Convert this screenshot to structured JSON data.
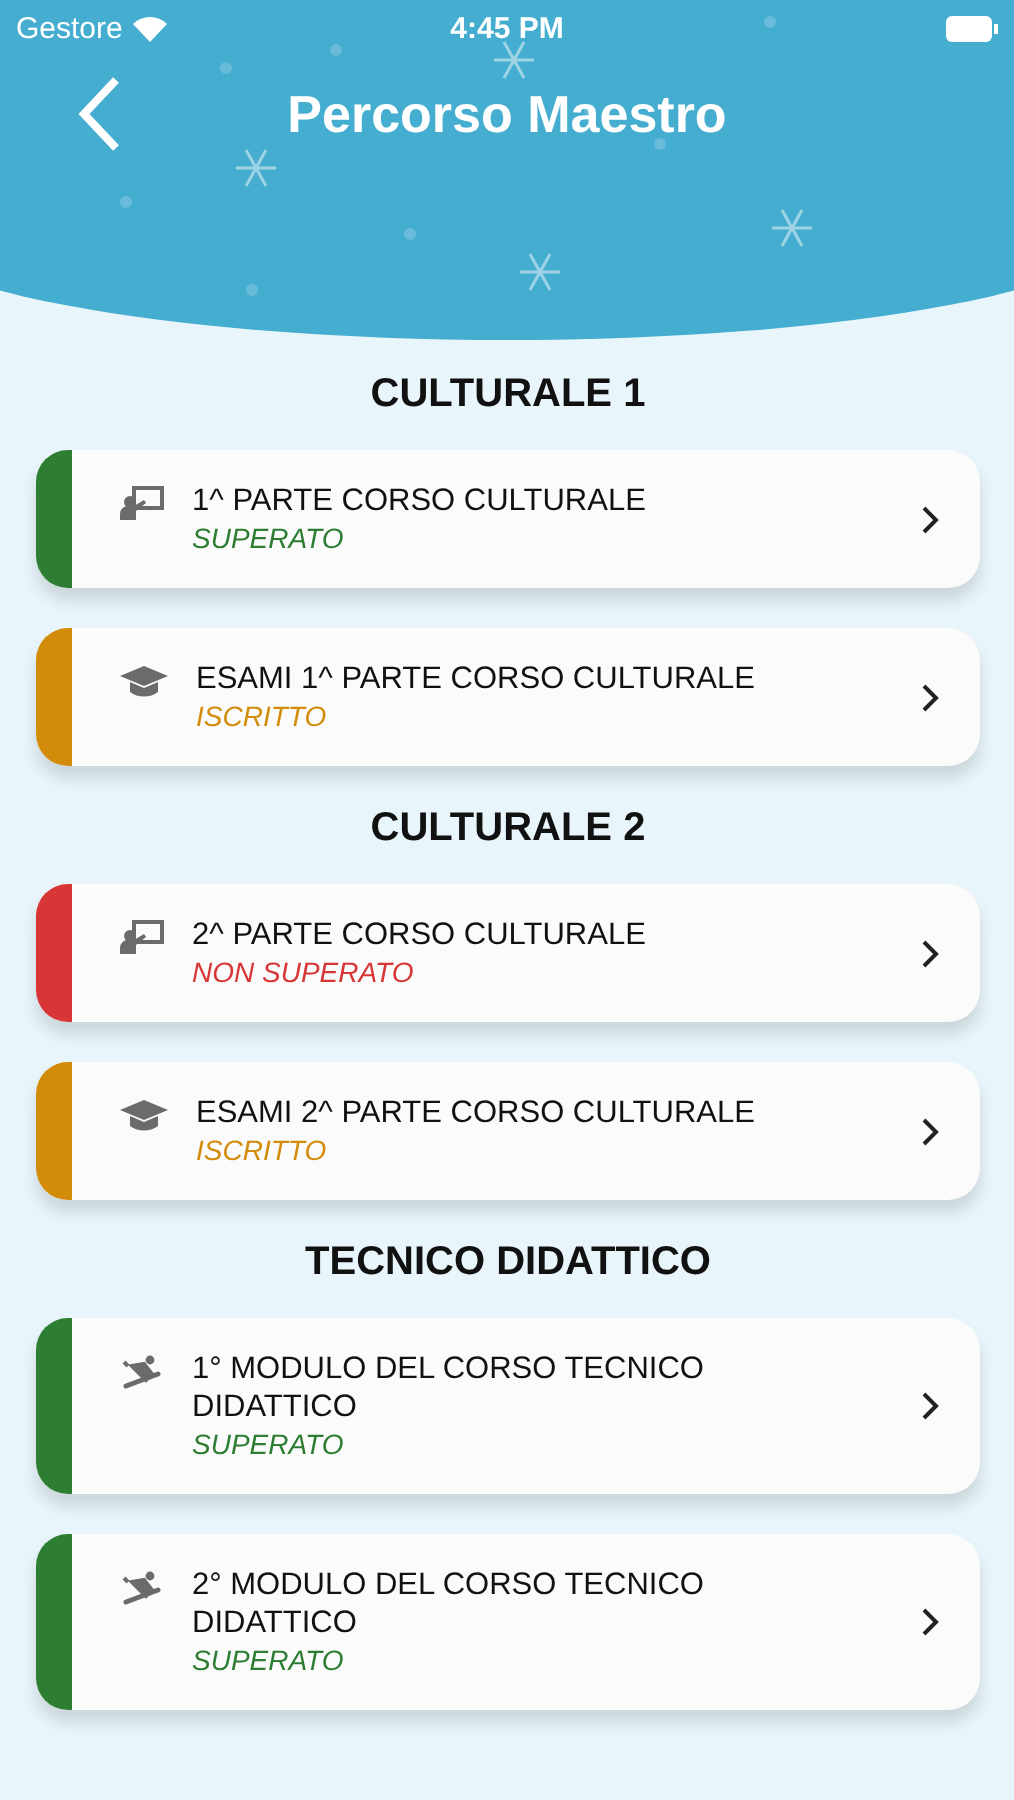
{
  "status_bar": {
    "carrier": "Gestore",
    "time": "4:45 PM"
  },
  "header": {
    "title": "Percorso Maestro"
  },
  "sections": [
    {
      "title": "CULTURALE 1",
      "items": [
        {
          "kind": "teaching",
          "title": "1^ PARTE CORSO CULTURALE",
          "status": "SUPERATO",
          "color": "#2d7d32"
        },
        {
          "kind": "exam",
          "title": "ESAMI 1^ PARTE CORSO CULTURALE",
          "status": "ISCRITTO",
          "color": "#d38b0a"
        }
      ]
    },
    {
      "title": "CULTURALE 2",
      "items": [
        {
          "kind": "teaching",
          "title": "2^ PARTE CORSO CULTURALE",
          "status": "NON SUPERATO",
          "color": "#d83636"
        },
        {
          "kind": "exam",
          "title": "ESAMI 2^ PARTE CORSO CULTURALE",
          "status": "ISCRITTO",
          "color": "#d38b0a"
        }
      ]
    },
    {
      "title": "TECNICO DIDATTICO",
      "items": [
        {
          "kind": "snowboard",
          "title": "1° MODULO DEL CORSO TECNICO DIDATTICO",
          "status": "SUPERATO",
          "color": "#2d7d32"
        },
        {
          "kind": "snowboard",
          "title": "2° MODULO DEL CORSO TECNICO DIDATTICO",
          "status": "SUPERATO",
          "color": "#2d7d32"
        }
      ]
    }
  ]
}
